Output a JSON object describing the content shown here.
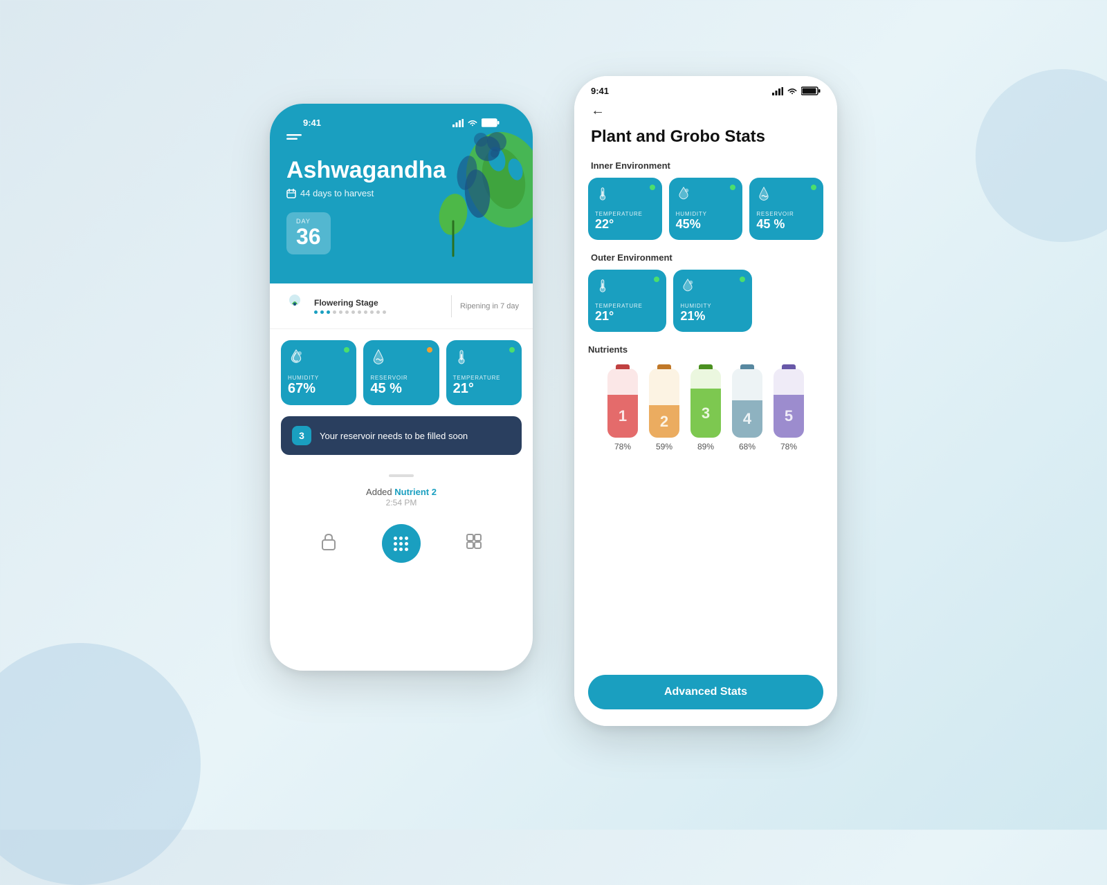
{
  "left_phone": {
    "status_bar": {
      "time": "9:41"
    },
    "header": {
      "plant_name": "Ashwagandha",
      "harvest_label": "44 days to harvest",
      "day_label": "DAY",
      "day_number": "36"
    },
    "stage": {
      "name": "Flowering Stage",
      "next": "Ripening in 7 day"
    },
    "metrics": [
      {
        "label": "HUMIDITY",
        "value": "67%",
        "status": "green"
      },
      {
        "label": "RESERVOIR",
        "value": "45 %",
        "status": "orange"
      },
      {
        "label": "TEMPERATURE",
        "value": "21°",
        "status": "green"
      }
    ],
    "alert": {
      "number": "3",
      "text": "Your reservoir needs to be filled soon"
    },
    "log": {
      "prefix": "Added",
      "highlight": "Nutrient 2",
      "time": "2:54 PM"
    }
  },
  "right_phone": {
    "status_bar": {
      "time": "9:41"
    },
    "back_label": "←",
    "title": "Plant and Grobo Stats",
    "inner_environment": {
      "label": "Inner Environment",
      "stats": [
        {
          "label": "TEMPERATURE",
          "value": "22°",
          "status": "green"
        },
        {
          "label": "HUMIDITY",
          "value": "45%",
          "status": "green"
        },
        {
          "label": "RESERVOIR",
          "value": "45 %",
          "status": "green"
        }
      ]
    },
    "outer_environment": {
      "label": "Outer Environment",
      "stats": [
        {
          "label": "TEMPERATURE",
          "value": "21°",
          "status": "green"
        },
        {
          "label": "HUMIDITY",
          "value": "21%",
          "status": "green"
        }
      ]
    },
    "nutrients": {
      "label": "Nutrients",
      "items": [
        {
          "number": "1",
          "pct": "78%",
          "color": "#e05a5a",
          "bg_color": "#f0a0a0",
          "cap_color": "#c04040"
        },
        {
          "number": "2",
          "pct": "59%",
          "color": "#e8a050",
          "bg_color": "#f5d090",
          "cap_color": "#c07828"
        },
        {
          "number": "3",
          "pct": "89%",
          "color": "#6cc040",
          "bg_color": "#b0e080",
          "cap_color": "#4a9020"
        },
        {
          "number": "4",
          "pct": "68%",
          "color": "#80a8b8",
          "bg_color": "#b8cfd8",
          "cap_color": "#5888a0"
        },
        {
          "number": "5",
          "pct": "78%",
          "color": "#9080c8",
          "bg_color": "#c0b0e0",
          "cap_color": "#6858a8"
        }
      ]
    },
    "advanced_stats_label": "Advanced Stats"
  }
}
